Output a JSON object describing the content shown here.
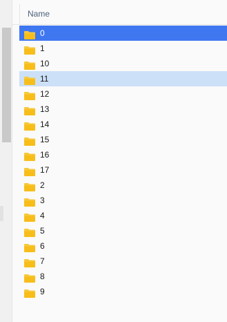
{
  "header": {
    "name_column": "Name"
  },
  "colors": {
    "selected_row": "#3f77f0",
    "hover_row": "#cce0f7",
    "folder": "#f8c83a"
  },
  "rows": [
    {
      "label": "0",
      "icon": "folder-icon",
      "state": "selected"
    },
    {
      "label": "1",
      "icon": "folder-icon",
      "state": "normal"
    },
    {
      "label": "10",
      "icon": "folder-icon",
      "state": "normal"
    },
    {
      "label": "11",
      "icon": "folder-icon",
      "state": "hover"
    },
    {
      "label": "12",
      "icon": "folder-icon",
      "state": "normal"
    },
    {
      "label": "13",
      "icon": "folder-icon",
      "state": "normal"
    },
    {
      "label": "14",
      "icon": "folder-icon",
      "state": "normal"
    },
    {
      "label": "15",
      "icon": "folder-icon",
      "state": "normal"
    },
    {
      "label": "16",
      "icon": "folder-icon",
      "state": "normal"
    },
    {
      "label": "17",
      "icon": "folder-icon",
      "state": "normal"
    },
    {
      "label": "2",
      "icon": "folder-icon",
      "state": "normal"
    },
    {
      "label": "3",
      "icon": "folder-icon",
      "state": "normal"
    },
    {
      "label": "4",
      "icon": "folder-icon",
      "state": "normal"
    },
    {
      "label": "5",
      "icon": "folder-icon",
      "state": "normal"
    },
    {
      "label": "6",
      "icon": "folder-icon",
      "state": "normal"
    },
    {
      "label": "7",
      "icon": "folder-icon",
      "state": "normal"
    },
    {
      "label": "8",
      "icon": "folder-icon",
      "state": "normal"
    },
    {
      "label": "9",
      "icon": "folder-icon",
      "state": "normal"
    }
  ]
}
